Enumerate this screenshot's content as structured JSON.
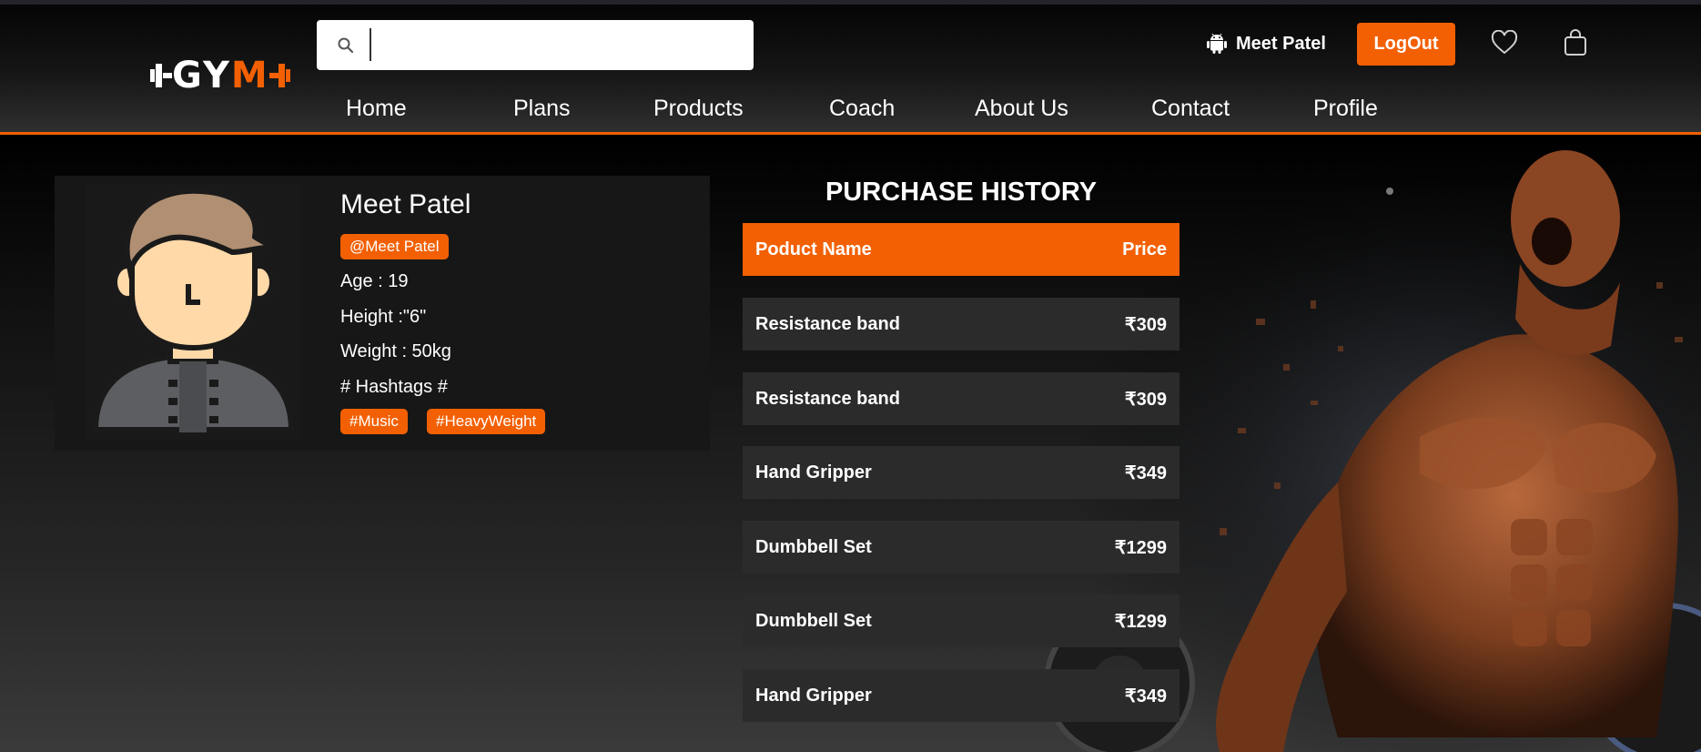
{
  "header": {
    "logo": {
      "part1": "GY",
      "part2": "M"
    },
    "search": {
      "value": "",
      "placeholder": ""
    },
    "user_name": "Meet Patel",
    "logout_label": "LogOut",
    "nav": [
      "Home",
      "Plans",
      "Products",
      "Coach",
      "About Us",
      "Contact",
      "Profile"
    ]
  },
  "profile": {
    "name": "Meet Patel",
    "handle": "@Meet Patel",
    "age": "Age : 19",
    "height": "Height :\"6\"",
    "weight": "Weight : 50kg",
    "hashtags_label": "# Hashtags #",
    "hashtags": [
      "#Music",
      "#HeavyWeight"
    ]
  },
  "purchase_history": {
    "title": "PURCHASE HISTORY",
    "columns": [
      "Poduct Name",
      "Price"
    ],
    "rows": [
      {
        "name": "Resistance band",
        "price": "₹309"
      },
      {
        "name": "Resistance band",
        "price": "₹309"
      },
      {
        "name": "Hand Gripper",
        "price": "₹349"
      },
      {
        "name": "Dumbbell Set",
        "price": "₹1299"
      },
      {
        "name": "Dumbbell Set",
        "price": "₹1299"
      },
      {
        "name": "Hand Gripper",
        "price": "₹349"
      }
    ]
  },
  "colors": {
    "accent": "#f26003",
    "card": "#171717",
    "row": "#2b2b2b"
  },
  "icons": [
    "search-icon",
    "android-icon",
    "heart-icon",
    "shopping-bag-icon",
    "dumbbell-icon"
  ]
}
